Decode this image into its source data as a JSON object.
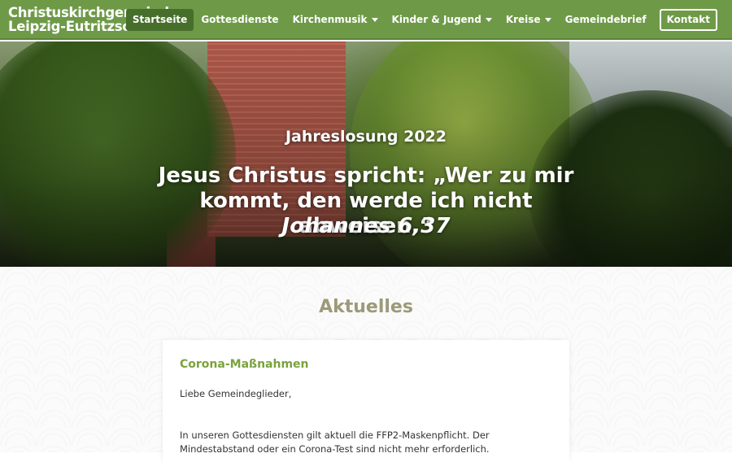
{
  "site": {
    "brand_line1": "Christuskirchgemeinde",
    "brand_line2": "Leipzig-Eutritzsch",
    "brand_color": "#6e9a48"
  },
  "nav": {
    "items": [
      {
        "label": "Startseite",
        "active": true,
        "dropdown": false
      },
      {
        "label": "Gottesdienste",
        "active": false,
        "dropdown": false
      },
      {
        "label": "Kirchenmusik",
        "active": false,
        "dropdown": true
      },
      {
        "label": "Kinder & Jugend",
        "active": false,
        "dropdown": true
      },
      {
        "label": "Kreise",
        "active": false,
        "dropdown": true
      },
      {
        "label": "Gemeindebrief",
        "active": false,
        "dropdown": false
      }
    ],
    "cta_label": "Kontakt"
  },
  "hero": {
    "kicker": "Jahreslosung 2022",
    "quote": "Jesus Christus spricht: „Wer zu mir kommt, den werde ich nicht abweisen.“",
    "reference": "Johannes 6,37"
  },
  "news": {
    "section_title": "Aktuelles",
    "card": {
      "title": "Corona-Maßnahmen",
      "greeting": "Liebe Gemeindeglieder,",
      "body": "In unseren Gottesdiensten gilt aktuell die FFP2-Maskenpflicht. Der Mindestabstand oder ein Corona-Test sind nicht mehr erforderlich."
    }
  }
}
